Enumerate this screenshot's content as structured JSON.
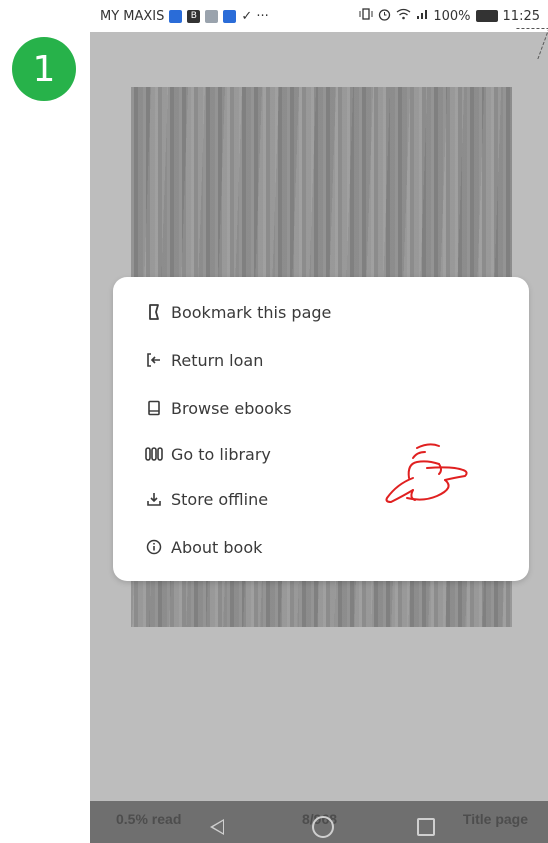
{
  "step_number": "1",
  "status_bar": {
    "carrier": "MY MAXIS",
    "more": "✓ ···",
    "battery_text": "100%",
    "time": "11:25"
  },
  "menu": {
    "items": [
      {
        "label": "Bookmark this page",
        "icon": "bookmark-icon"
      },
      {
        "label": "Return loan",
        "icon": "return-icon"
      },
      {
        "label": "Browse ebooks",
        "icon": "book-icon"
      },
      {
        "label": "Go to library",
        "icon": "library-icon"
      },
      {
        "label": "Store offline",
        "icon": "download-icon"
      },
      {
        "label": "About book",
        "icon": "info-icon"
      }
    ]
  },
  "reader_footer": {
    "progress_text": "0.5% read",
    "page_text": "8/968",
    "section_text": "Title page"
  },
  "colors": {
    "badge": "#27b24a",
    "annotation": "#e02020",
    "overlay": "#bdbdbd"
  }
}
